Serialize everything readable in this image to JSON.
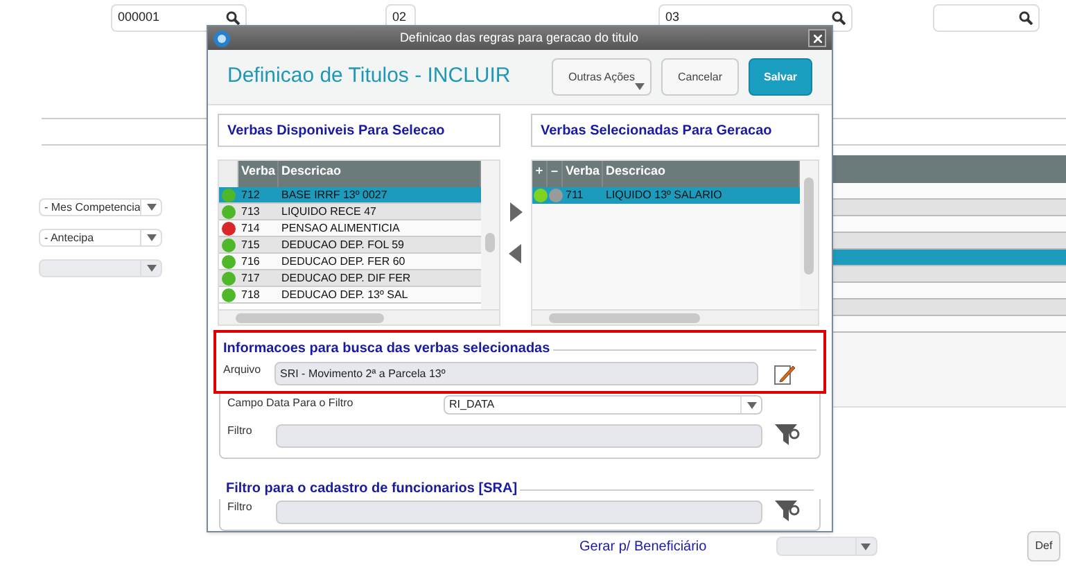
{
  "background": {
    "top_fields": [
      {
        "value": "000001",
        "kind": "search"
      },
      {
        "value": "02",
        "kind": "plain"
      },
      {
        "value": "03",
        "kind": "search"
      },
      {
        "kind": "search"
      }
    ],
    "left_selects": [
      {
        "value": "- Mes Competencia",
        "disabled": false
      },
      {
        "value": "- Antecipa",
        "disabled": false
      },
      {
        "disabled": true
      }
    ],
    "right_table_rows": [
      {
        "selected": false
      },
      {
        "selected": false
      },
      {
        "selected": false
      },
      {
        "selected": false
      },
      {
        "selected": true
      },
      {
        "selected": false
      },
      {
        "selected": false
      },
      {
        "selected": false
      },
      {
        "selected": false
      }
    ],
    "bottom_label": "Gerar p/ Beneficiário",
    "bottom_select": {
      "disabled": true
    },
    "bottom_button": "Def"
  },
  "dialog": {
    "title": "Definicao das regras para geracao do titulo",
    "heading": "Definicao de Titulos - INCLUIR",
    "buttons": [
      {
        "label": "Outras Ações",
        "kind": "menu"
      },
      {
        "label": "Cancelar",
        "kind": "default"
      },
      {
        "label": "Salvar",
        "kind": "primary"
      }
    ],
    "available": {
      "title": "Verbas Disponiveis Para Selecao",
      "columns": [
        "Verba",
        "Descricao"
      ],
      "rows": [
        {
          "color": "#4fb82a",
          "verba": "712",
          "descricao": "BASE IRRF 13º 0027",
          "selected": true
        },
        {
          "color": "#4fb82a",
          "verba": "713",
          "descricao": "LIQUIDO RECE 47",
          "selected": false
        },
        {
          "color": "#d8262a",
          "verba": "714",
          "descricao": "PENSAO ALIMENTICIA",
          "selected": false
        },
        {
          "color": "#4fb82a",
          "verba": "715",
          "descricao": "DEDUCAO DEP. FOL 59",
          "selected": false
        },
        {
          "color": "#4fb82a",
          "verba": "716",
          "descricao": "DEDUCAO DEP. FER 60",
          "selected": false
        },
        {
          "color": "#4fb82a",
          "verba": "717",
          "descricao": "DEDUCAO DEP. DIF FER",
          "selected": false
        },
        {
          "color": "#4fb82a",
          "verba": "718",
          "descricao": "DEDUCAO DEP. 13º SAL",
          "selected": false
        }
      ]
    },
    "chosen": {
      "title": "Verbas Selecionadas Para Geracao",
      "columns": [
        "+",
        "–",
        "Verba",
        "Descricao"
      ],
      "rows": [
        {
          "dots": [
            {
              "color": "#7ed321"
            },
            {
              "color": "#9a9a9a"
            }
          ],
          "verba": "711",
          "descricao": "LIQUIDO 13º SALARIO",
          "selected": true
        }
      ]
    },
    "search_group": {
      "title": "Informacoes para busca das verbas selecionadas",
      "highlighted": true,
      "arquivo_label": "Arquivo",
      "arquivo_value": "SRI - Movimento 2ª a Parcela 13º",
      "campo_label": "Campo Data Para o Filtro",
      "campo_value": "RI_DATA",
      "filtro_label": "Filtro"
    },
    "employee_group": {
      "title": "Filtro para o cadastro de funcionarios [SRA]",
      "filtro_label": "Filtro"
    }
  }
}
